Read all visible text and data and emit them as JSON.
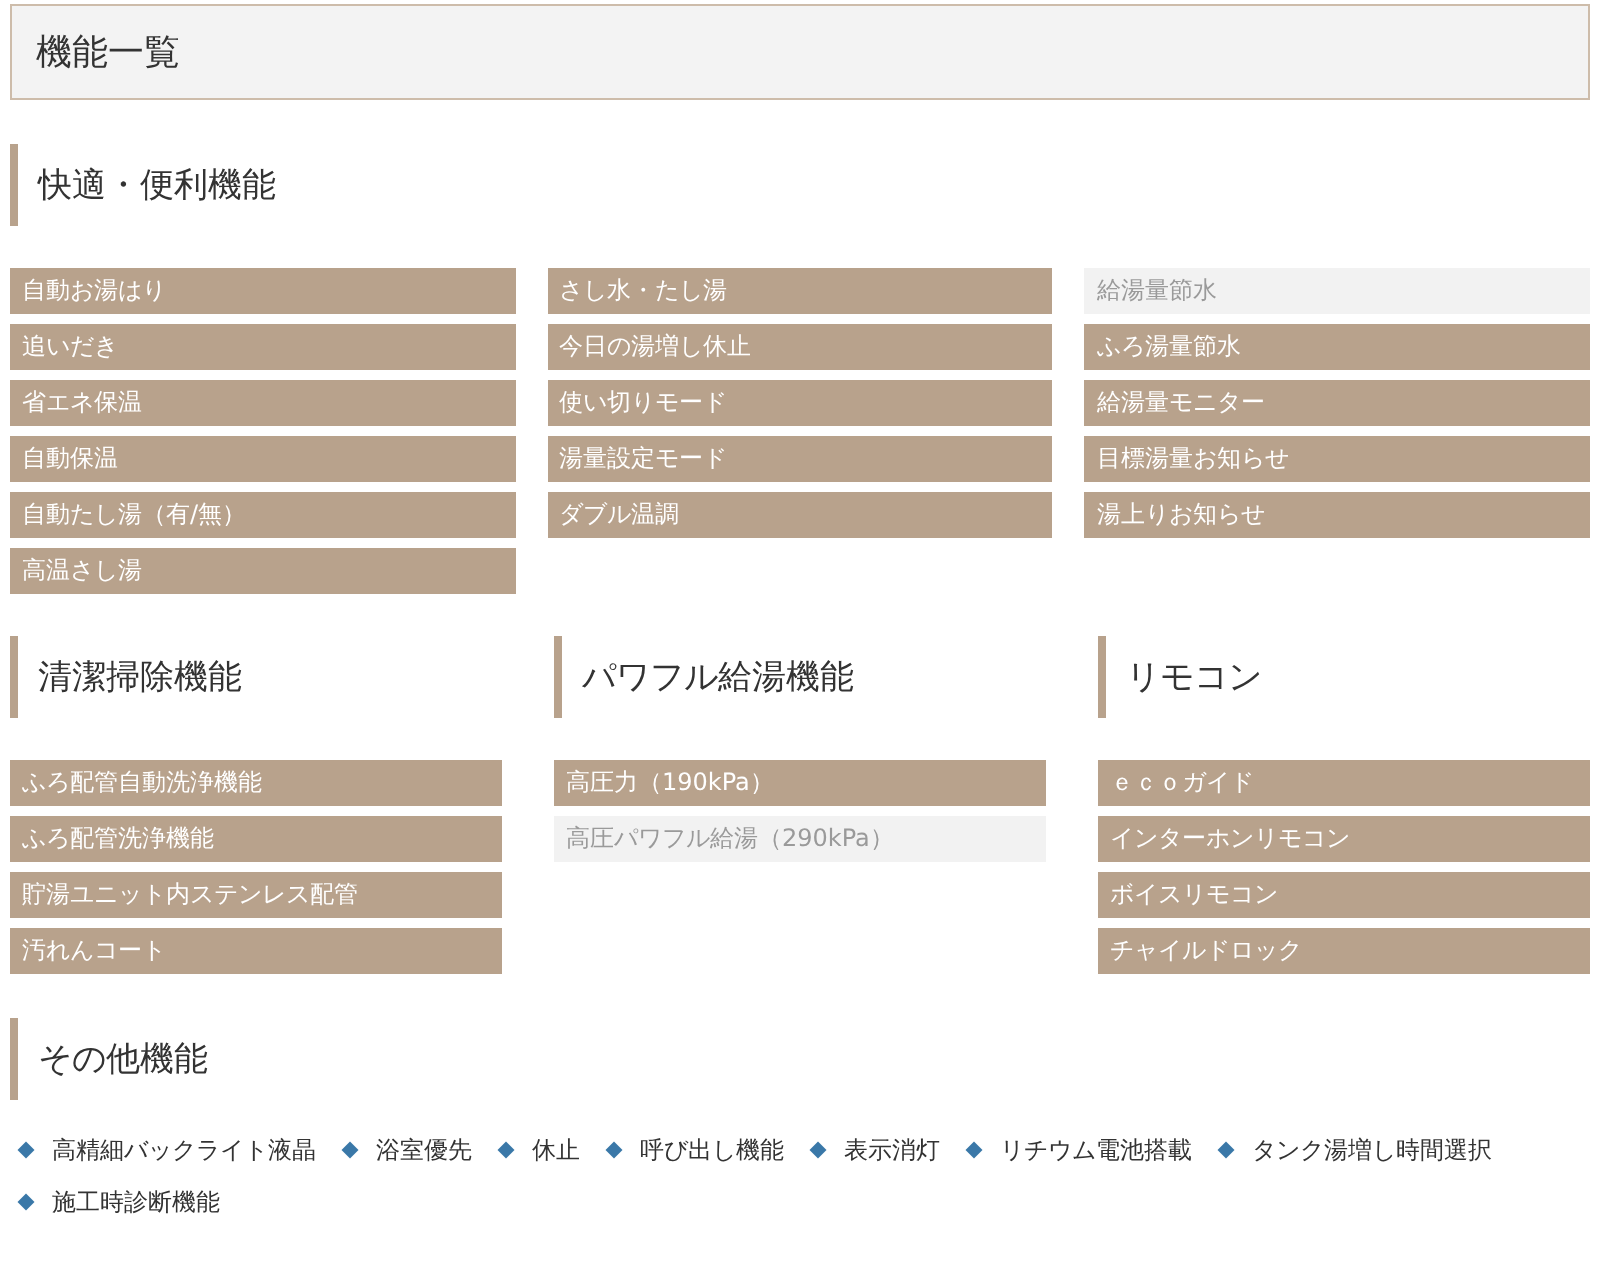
{
  "title": "機能一覧",
  "convenience": {
    "heading": "快適・便利機能",
    "columns": [
      [
        {
          "label": "自動お湯はり",
          "available": true
        },
        {
          "label": "追いだき",
          "available": true
        },
        {
          "label": "省エネ保温",
          "available": true
        },
        {
          "label": "自動保温",
          "available": true
        },
        {
          "label": "自動たし湯（有/無）",
          "available": true
        },
        {
          "label": "高温さし湯",
          "available": true
        }
      ],
      [
        {
          "label": "さし水・たし湯",
          "available": true
        },
        {
          "label": "今日の湯増し休止",
          "available": true
        },
        {
          "label": "使い切りモード",
          "available": true
        },
        {
          "label": "湯量設定モード",
          "available": true
        },
        {
          "label": "ダブル温調",
          "available": true
        }
      ],
      [
        {
          "label": "給湯量節水",
          "available": false
        },
        {
          "label": "ふろ湯量節水",
          "available": true
        },
        {
          "label": "給湯量モニター",
          "available": true
        },
        {
          "label": "目標湯量お知らせ",
          "available": true
        },
        {
          "label": "湯上りお知らせ",
          "available": true
        }
      ]
    ]
  },
  "groups": [
    {
      "heading": "清潔掃除機能",
      "items": [
        {
          "label": "ふろ配管自動洗浄機能",
          "available": true
        },
        {
          "label": "ふろ配管洗浄機能",
          "available": true
        },
        {
          "label": "貯湯ユニット内ステンレス配管",
          "available": true
        },
        {
          "label": "汚れんコート",
          "available": true
        }
      ]
    },
    {
      "heading": "パワフル給湯機能",
      "items": [
        {
          "label": "高圧力（190kPa）",
          "available": true
        },
        {
          "label": "高圧パワフル給湯（290kPa）",
          "available": false
        }
      ]
    },
    {
      "heading": "リモコン",
      "items": [
        {
          "label": "ｅｃｏガイド",
          "available": true
        },
        {
          "label": "インターホンリモコン",
          "available": true
        },
        {
          "label": "ボイスリモコン",
          "available": true
        },
        {
          "label": "チャイルドロック",
          "available": true
        }
      ]
    }
  ],
  "other": {
    "heading": "その他機能",
    "items": [
      "高精細バックライト液晶",
      "浴室優先",
      "休止",
      "呼び出し機能",
      "表示消灯",
      "リチウム電池搭載",
      "タンク湯増し時間選択",
      "施工時診断機能"
    ]
  }
}
